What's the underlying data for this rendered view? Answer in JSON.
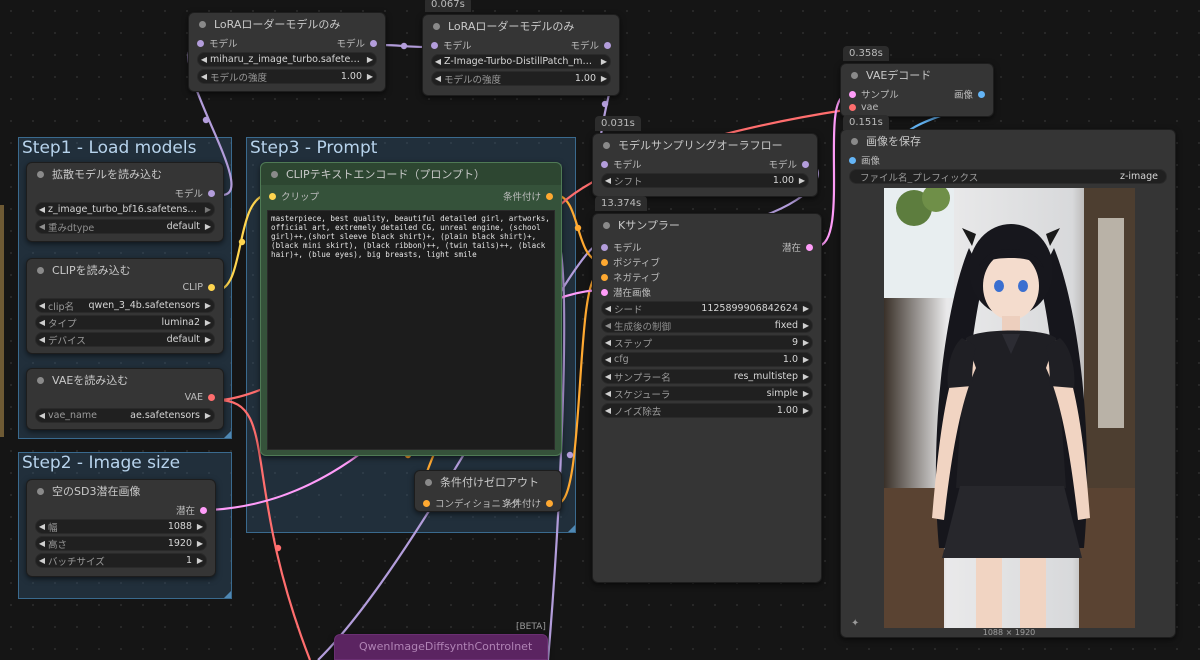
{
  "groups": {
    "step1": "Step1 - Load models",
    "step2": "Step2 - Image size",
    "step3": "Step3 - Prompt"
  },
  "nodes": {
    "lora1": {
      "title": "LoRAローダーモデルのみ",
      "in_model": "モデル",
      "out_model": "モデル",
      "lora_value": "miharu_z_image_turbo.safeten ...",
      "strength_label": "モデルの強度",
      "strength_value": "1.00"
    },
    "lora2": {
      "badge": "0.067s",
      "title": "LoRAローダーモデルのみ",
      "in_model": "モデル",
      "out_model": "モデル",
      "lora_value": "Z-Image-Turbo-DistillPatch_mo...",
      "strength_label": "モデルの強度",
      "strength_value": "1.00"
    },
    "diffusion": {
      "title": "拡散モデルを読み込む",
      "out_model": "モデル",
      "unet_value": "z_image_turbo_bf16.safetensors",
      "dtype_label": "重みdtype",
      "dtype_value": "default"
    },
    "clip_loader": {
      "title": "CLIPを読み込む",
      "out_clip": "CLIP",
      "clip_name_label": "clip名",
      "clip_name_value": "qwen_3_4b.safetensors",
      "type_label": "タイプ",
      "type_value": "lumina2",
      "device_label": "デバイス",
      "device_value": "default"
    },
    "vae_loader": {
      "title": "VAEを読み込む",
      "out_vae": "VAE",
      "vae_name_label": "vae_name",
      "vae_name_value": "ae.safetensors"
    },
    "latent": {
      "title": "空のSD3潜在画像",
      "out_latent": "潜在",
      "width_label": "幅",
      "width_value": "1088",
      "height_label": "高さ",
      "height_value": "1920",
      "batch_label": "バッチサイズ",
      "batch_value": "1"
    },
    "clip_encode": {
      "title": "CLIPテキストエンコード（プロンプト）",
      "in_clip": "クリップ",
      "out_cond": "条件付け",
      "prompt": "masterpiece, best quality, beautiful detailed girl, artworks, official art, extremely detailed CG, unreal engine, (school girl)++,(short sleeve black shirt)+, (plain black shirt)+, (black mini skirt), (black ribbon)++, (twin tails)++, (black hair)+, (blue eyes), big breasts, light smile"
    },
    "cond_zero": {
      "title": "条件付けゼロアウト",
      "in_cond": "コンディショニング",
      "out_cond": "条件付け"
    },
    "model_sampling": {
      "badge": "0.031s",
      "title": "モデルサンプリングオーラフロー",
      "in_model": "モデル",
      "out_model": "モデル",
      "shift_label": "シフト",
      "shift_value": "1.00"
    },
    "ksampler": {
      "badge": "13.374s",
      "title": "Kサンプラー",
      "in_model": "モデル",
      "in_pos": "ポジティブ",
      "in_neg": "ネガティブ",
      "in_latent": "潜在画像",
      "out_latent": "潜在",
      "seed_label": "シード",
      "seed_value": "1125899906842624",
      "control_label": "生成後の制御",
      "control_value": "fixed",
      "steps_label": "ステップ",
      "steps_value": "9",
      "cfg_label": "cfg",
      "cfg_value": "1.0",
      "sampler_label": "サンプラー名",
      "sampler_value": "res_multistep",
      "scheduler_label": "スケジューラ",
      "scheduler_value": "simple",
      "denoise_label": "ノイズ除去",
      "denoise_value": "1.00"
    },
    "vae_decode": {
      "badge": "0.358s",
      "title": "VAEデコード",
      "in_samples": "サンプル",
      "in_vae": "vae",
      "out_image": "画像"
    },
    "save_image": {
      "badge": "0.151s",
      "title": "画像を保存",
      "in_image": "画像",
      "prefix_label": "ファイル名_プレフィックス",
      "prefix_value": "z-image",
      "image_size": "1088 × 1920"
    },
    "controlnet": {
      "badge": "[BETA]",
      "title": "QwenImageDiffsynthControlnet"
    }
  },
  "colors": {
    "model": "#b39ddb",
    "clip": "#ffd54f",
    "vae": "#ff6e6e",
    "latent": "#ff9cf9",
    "cond": "#ffa931",
    "image": "#64b5f6",
    "group_bg": "#34597a",
    "green_node": "#35523a"
  }
}
